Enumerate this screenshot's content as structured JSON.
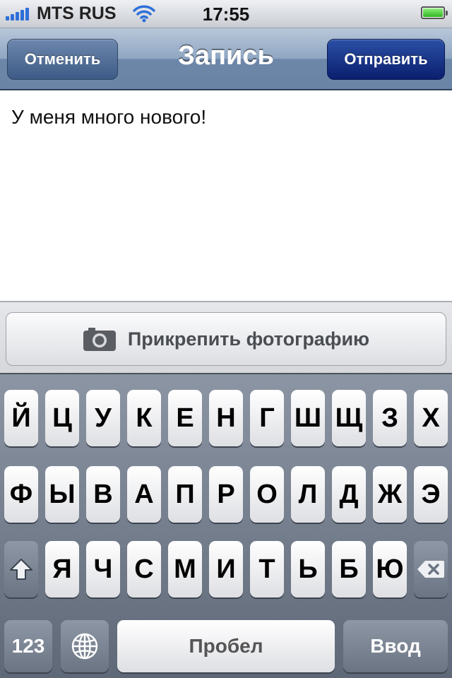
{
  "status_bar": {
    "carrier": "MTS RUS",
    "time": "17:55",
    "battery_level": 1.0,
    "signal_icon": "signal-bars-icon",
    "wifi_icon": "wifi-icon",
    "battery_icon": "battery-icon"
  },
  "nav": {
    "cancel_label": "Отменить",
    "title": "Запись",
    "send_label": "Отправить"
  },
  "compose": {
    "text": "У меня много нового!"
  },
  "attach": {
    "label": "Прикрепить фотографию",
    "icon": "camera-icon"
  },
  "keyboard": {
    "row1": [
      "Й",
      "Ц",
      "У",
      "К",
      "Е",
      "Н",
      "Г",
      "Ш",
      "Щ",
      "З",
      "Х"
    ],
    "row2": [
      "Ф",
      "Ы",
      "В",
      "А",
      "П",
      "Р",
      "О",
      "Л",
      "Д",
      "Ж",
      "Э"
    ],
    "row3": [
      "Я",
      "Ч",
      "С",
      "М",
      "И",
      "Т",
      "Ь",
      "Б",
      "Ю"
    ],
    "numbers_label": "123",
    "space_label": "Пробел",
    "enter_label": "Ввод",
    "shift_icon": "shift-icon",
    "backspace_icon": "backspace-icon",
    "globe_icon": "globe-icon"
  }
}
